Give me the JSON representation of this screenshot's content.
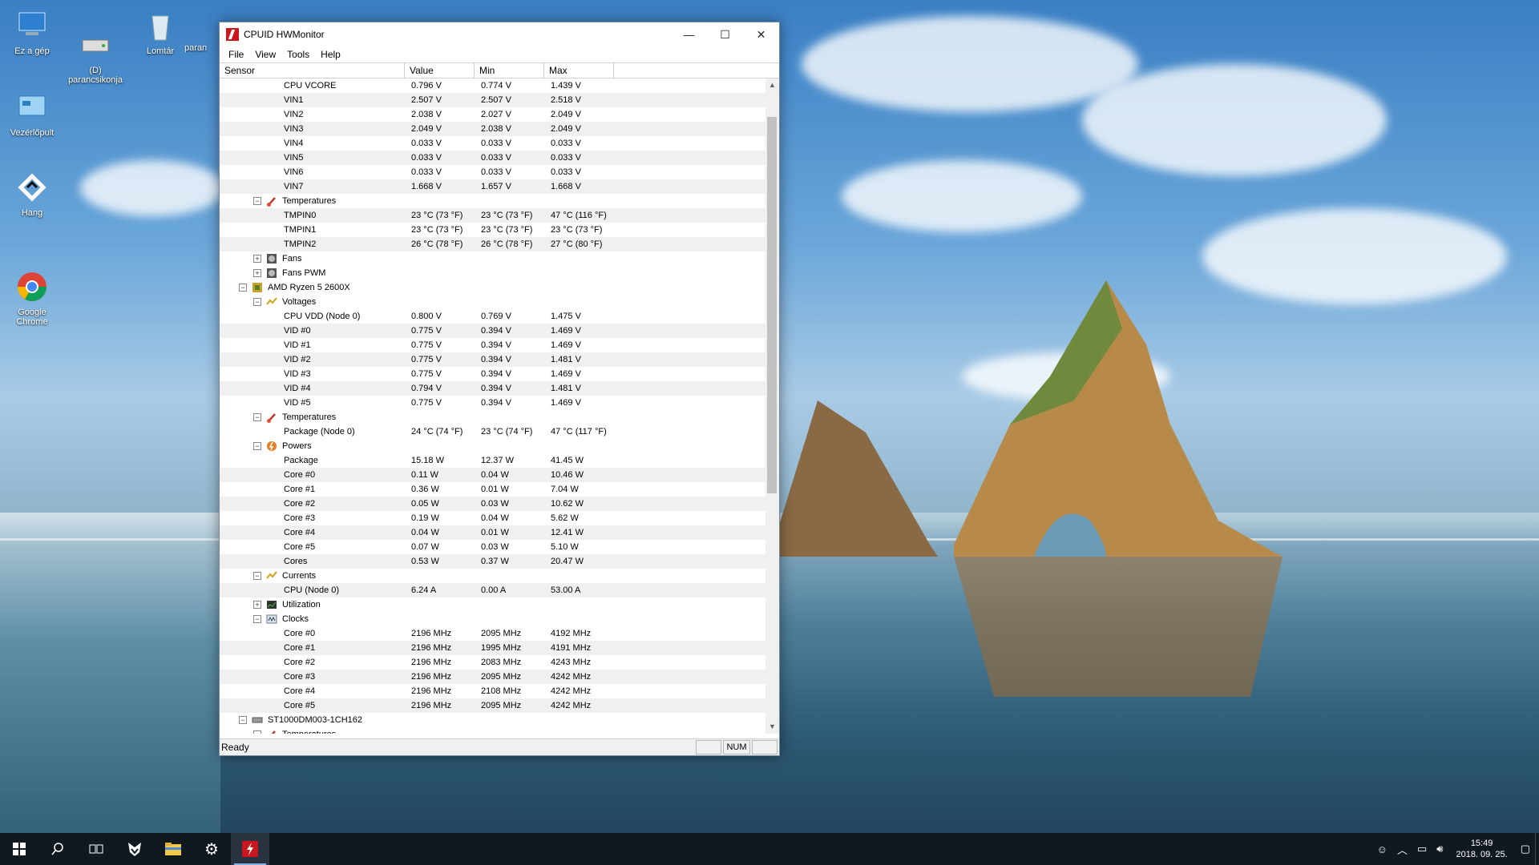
{
  "desktop": {
    "icons": [
      {
        "label": "Ez a gép"
      },
      {
        "label": "(D)\nparancsikonja"
      },
      {
        "label": "Lomtár"
      },
      {
        "label": "paran"
      },
      {
        "label": "Vezérlőpult"
      },
      {
        "label": "Hang"
      },
      {
        "label": "Google\nChrome"
      }
    ]
  },
  "window": {
    "title": "CPUID HWMonitor",
    "menu": [
      "File",
      "View",
      "Tools",
      "Help"
    ],
    "columns": [
      "Sensor",
      "Value",
      "Min",
      "Max"
    ],
    "status": "Ready",
    "num_indicator": "NUM",
    "rows": [
      {
        "level": 3,
        "name": "CPU VCORE",
        "value": "0.796 V",
        "min": "0.774 V",
        "max": "1.439 V"
      },
      {
        "level": 3,
        "name": "VIN1",
        "value": "2.507 V",
        "min": "2.507 V",
        "max": "2.518 V"
      },
      {
        "level": 3,
        "name": "VIN2",
        "value": "2.038 V",
        "min": "2.027 V",
        "max": "2.049 V"
      },
      {
        "level": 3,
        "name": "VIN3",
        "value": "2.049 V",
        "min": "2.038 V",
        "max": "2.049 V"
      },
      {
        "level": 3,
        "name": "VIN4",
        "value": "0.033 V",
        "min": "0.033 V",
        "max": "0.033 V"
      },
      {
        "level": 3,
        "name": "VIN5",
        "value": "0.033 V",
        "min": "0.033 V",
        "max": "0.033 V"
      },
      {
        "level": 3,
        "name": "VIN6",
        "value": "0.033 V",
        "min": "0.033 V",
        "max": "0.033 V"
      },
      {
        "level": 3,
        "name": "VIN7",
        "value": "1.668 V",
        "min": "1.657 V",
        "max": "1.668 V"
      },
      {
        "level": 2,
        "name": "Temperatures",
        "toggle": "−",
        "icon": "temp",
        "value": "",
        "min": "",
        "max": ""
      },
      {
        "level": 3,
        "name": "TMPIN0",
        "value": "23 °C  (73 °F)",
        "min": "23 °C  (73 °F)",
        "max": "47 °C  (116 °F)"
      },
      {
        "level": 3,
        "name": "TMPIN1",
        "value": "23 °C  (73 °F)",
        "min": "23 °C  (73 °F)",
        "max": "23 °C  (73 °F)"
      },
      {
        "level": 3,
        "name": "TMPIN2",
        "value": "26 °C  (78 °F)",
        "min": "26 °C  (78 °F)",
        "max": "27 °C  (80 °F)"
      },
      {
        "level": 2,
        "name": "Fans",
        "toggle": "+",
        "icon": "fan",
        "value": "",
        "min": "",
        "max": ""
      },
      {
        "level": 2,
        "name": "Fans PWM",
        "toggle": "+",
        "icon": "fan",
        "value": "",
        "min": "",
        "max": ""
      },
      {
        "level": 1,
        "name": "AMD Ryzen 5 2600X",
        "toggle": "−",
        "icon": "chip",
        "value": "",
        "min": "",
        "max": ""
      },
      {
        "level": 2,
        "name": "Voltages",
        "toggle": "−",
        "icon": "volt",
        "value": "",
        "min": "",
        "max": ""
      },
      {
        "level": 3,
        "name": "CPU VDD (Node 0)",
        "value": "0.800 V",
        "min": "0.769 V",
        "max": "1.475 V"
      },
      {
        "level": 3,
        "name": "VID #0",
        "value": "0.775 V",
        "min": "0.394 V",
        "max": "1.469 V"
      },
      {
        "level": 3,
        "name": "VID #1",
        "value": "0.775 V",
        "min": "0.394 V",
        "max": "1.469 V"
      },
      {
        "level": 3,
        "name": "VID #2",
        "value": "0.775 V",
        "min": "0.394 V",
        "max": "1.481 V"
      },
      {
        "level": 3,
        "name": "VID #3",
        "value": "0.775 V",
        "min": "0.394 V",
        "max": "1.469 V"
      },
      {
        "level": 3,
        "name": "VID #4",
        "value": "0.794 V",
        "min": "0.394 V",
        "max": "1.481 V"
      },
      {
        "level": 3,
        "name": "VID #5",
        "value": "0.775 V",
        "min": "0.394 V",
        "max": "1.469 V"
      },
      {
        "level": 2,
        "name": "Temperatures",
        "toggle": "−",
        "icon": "temp",
        "value": "",
        "min": "",
        "max": ""
      },
      {
        "level": 3,
        "name": "Package (Node 0)",
        "value": "24 °C  (74 °F)",
        "min": "23 °C  (74 °F)",
        "max": "47 °C  (117 °F)"
      },
      {
        "level": 2,
        "name": "Powers",
        "toggle": "−",
        "icon": "power",
        "value": "",
        "min": "",
        "max": ""
      },
      {
        "level": 3,
        "name": "Package",
        "value": "15.18 W",
        "min": "12.37 W",
        "max": "41.45 W"
      },
      {
        "level": 3,
        "name": "Core #0",
        "value": "0.11 W",
        "min": "0.04 W",
        "max": "10.46 W"
      },
      {
        "level": 3,
        "name": "Core #1",
        "value": "0.36 W",
        "min": "0.01 W",
        "max": "7.04 W"
      },
      {
        "level": 3,
        "name": "Core #2",
        "value": "0.05 W",
        "min": "0.03 W",
        "max": "10.62 W"
      },
      {
        "level": 3,
        "name": "Core #3",
        "value": "0.19 W",
        "min": "0.04 W",
        "max": "5.62 W"
      },
      {
        "level": 3,
        "name": "Core #4",
        "value": "0.04 W",
        "min": "0.01 W",
        "max": "12.41 W"
      },
      {
        "level": 3,
        "name": "Core #5",
        "value": "0.07 W",
        "min": "0.03 W",
        "max": "5.10 W"
      },
      {
        "level": 3,
        "name": "Cores",
        "value": "0.53 W",
        "min": "0.37 W",
        "max": "20.47 W"
      },
      {
        "level": 2,
        "name": "Currents",
        "toggle": "−",
        "icon": "volt",
        "value": "",
        "min": "",
        "max": ""
      },
      {
        "level": 3,
        "name": "CPU (Node 0)",
        "value": "6.24 A",
        "min": "0.00 A",
        "max": "53.00 A"
      },
      {
        "level": 2,
        "name": "Utilization",
        "toggle": "+",
        "icon": "util",
        "value": "",
        "min": "",
        "max": ""
      },
      {
        "level": 2,
        "name": "Clocks",
        "toggle": "−",
        "icon": "clock",
        "value": "",
        "min": "",
        "max": ""
      },
      {
        "level": 3,
        "name": "Core #0",
        "value": "2196 MHz",
        "min": "2095 MHz",
        "max": "4192 MHz"
      },
      {
        "level": 3,
        "name": "Core #1",
        "value": "2196 MHz",
        "min": "1995 MHz",
        "max": "4191 MHz"
      },
      {
        "level": 3,
        "name": "Core #2",
        "value": "2196 MHz",
        "min": "2083 MHz",
        "max": "4243 MHz"
      },
      {
        "level": 3,
        "name": "Core #3",
        "value": "2196 MHz",
        "min": "2095 MHz",
        "max": "4242 MHz"
      },
      {
        "level": 3,
        "name": "Core #4",
        "value": "2196 MHz",
        "min": "2108 MHz",
        "max": "4242 MHz"
      },
      {
        "level": 3,
        "name": "Core #5",
        "value": "2196 MHz",
        "min": "2095 MHz",
        "max": "4242 MHz"
      },
      {
        "level": 1,
        "name": "ST1000DM003-1CH162",
        "toggle": "−",
        "icon": "disk",
        "value": "",
        "min": "",
        "max": ""
      },
      {
        "level": 2,
        "name": "Temperatures",
        "toggle": "−",
        "icon": "temp",
        "value": "",
        "min": "",
        "max": ""
      }
    ]
  },
  "taskbar": {
    "time": "15:49",
    "date": "2018. 09. 25."
  },
  "colors": {
    "app_red": "#c8181d",
    "taskbar": "#101820",
    "row_alt": "#f0f0f0"
  }
}
